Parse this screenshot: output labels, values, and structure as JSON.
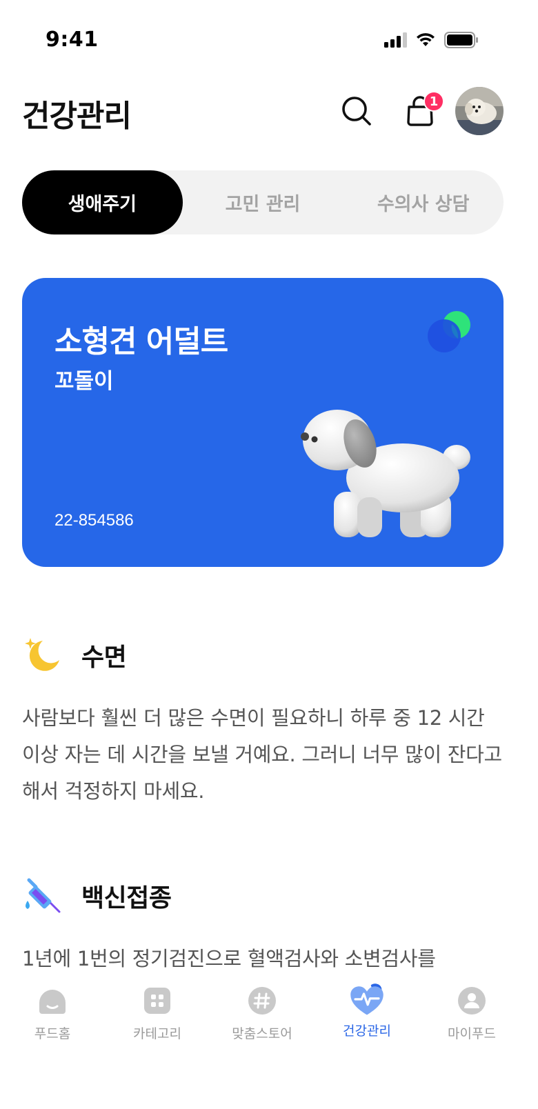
{
  "status_bar": {
    "time": "9:41"
  },
  "header": {
    "title": "건강관리",
    "cart_badge": "1"
  },
  "tabs": [
    {
      "label": "생애주기",
      "active": true
    },
    {
      "label": "고민 관리",
      "active": false
    },
    {
      "label": "수의사 상담",
      "active": false
    }
  ],
  "lifecycle_card": {
    "title": "소형견 어덜트",
    "pet_name": "꼬돌이",
    "id_number": "22-854586",
    "background_color": "#2667e8"
  },
  "sections": [
    {
      "icon": "crescent-moon-icon",
      "title": "수면",
      "body": "사람보다 훨씬 더 많은 수면이 필요하니 하루 중 12 시간 이상 자는 데 시간을 보낼 거예요. 그러니 너무 많이 잔다고 해서 걱정하지 마세요."
    },
    {
      "icon": "syringe-icon",
      "title": "백신접종",
      "body": "1년에 1번의 정기검진으로 혈액검사와 소변검사를"
    }
  ],
  "bottom_nav": {
    "items": [
      {
        "label": "푸드홈",
        "icon": "food-home-icon",
        "active": false
      },
      {
        "label": "카테고리",
        "icon": "category-grid-icon",
        "active": false
      },
      {
        "label": "맞춤스토어",
        "icon": "hashtag-icon",
        "active": false
      },
      {
        "label": "건강관리",
        "icon": "heart-pulse-icon",
        "active": true
      },
      {
        "label": "마이푸드",
        "icon": "user-profile-icon",
        "active": false
      }
    ],
    "active_color": "#2a66e6"
  }
}
